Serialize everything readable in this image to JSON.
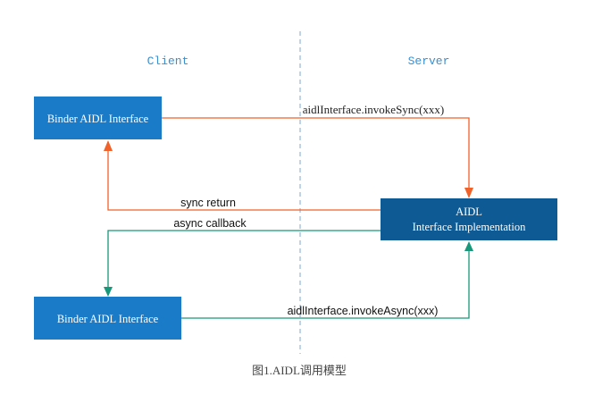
{
  "lanes": {
    "client": "Client",
    "server": "Server"
  },
  "boxes": {
    "client_top": "Binder AIDL Interface",
    "client_bottom": "Binder AIDL Interface",
    "server_line1": "AIDL",
    "server_line2": "Interface Implementation"
  },
  "edges": {
    "invoke_sync": "aidlInterface.invokeSync(xxx)",
    "sync_return": "sync return",
    "async_callback": "async callback",
    "invoke_async": "aidlInterface.invokeAsync(xxx)"
  },
  "caption": "图1.AIDL调用模型",
  "colors": {
    "client_box": "#1a7bc9",
    "server_box": "#0d5a94",
    "sync_arrow": "#f0622a",
    "async_arrow": "#17987a",
    "lane_divider": "#7fa9d0",
    "lane_label": "#3a8fd0"
  }
}
